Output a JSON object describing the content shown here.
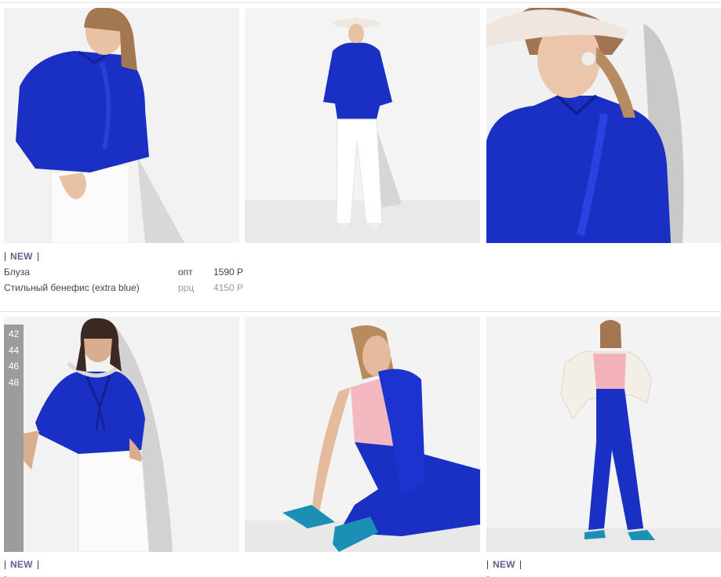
{
  "row1": {
    "badge": "NEW",
    "product_type": "Блуза",
    "product_name": "Стильный бенефис (extra blue)",
    "price_opt_label": "опт",
    "price_opt": "1590 Р",
    "price_rrc_label": "ррц",
    "price_rrc": "4150 Р"
  },
  "row2": {
    "sizes": [
      "42",
      "44",
      "46",
      "48"
    ],
    "badge_left": "NEW",
    "badge_right": "NEW",
    "dash_left": "-",
    "dash_right": "-"
  },
  "colors": {
    "cobalt": "#1a2fc4",
    "badge": "#6a5c8f",
    "size_strip": "#9c9c9c"
  }
}
